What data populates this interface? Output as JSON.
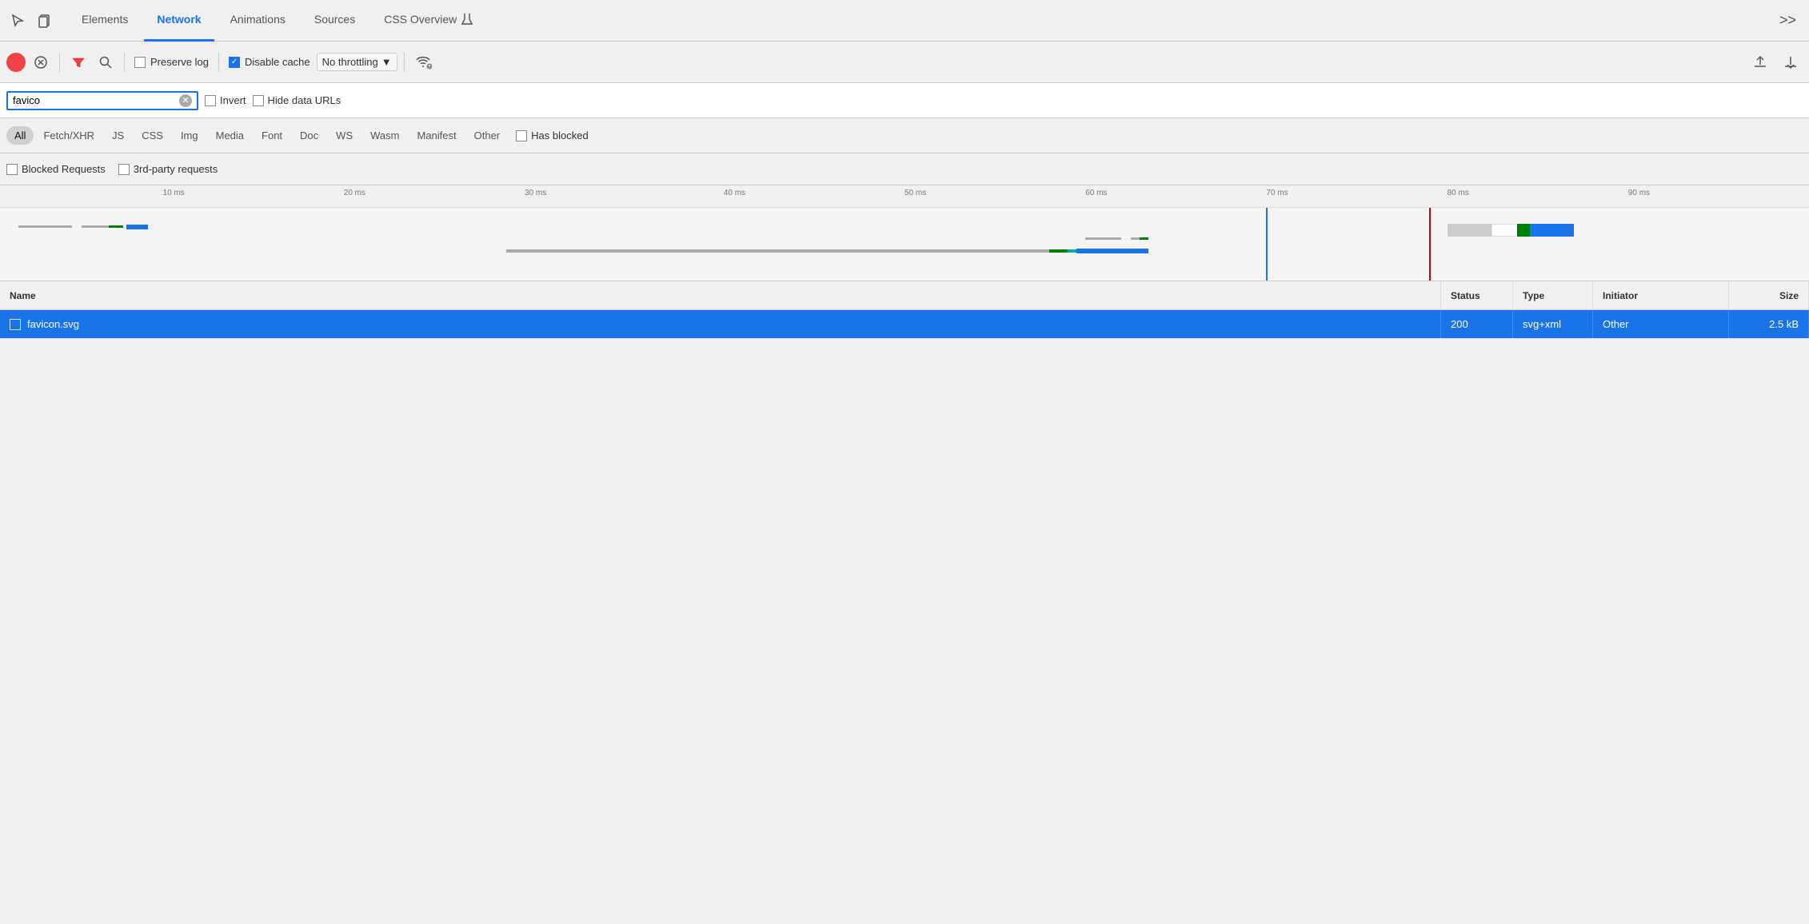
{
  "tabs": {
    "items": [
      {
        "label": "Elements",
        "active": false
      },
      {
        "label": "Network",
        "active": true
      },
      {
        "label": "Animations",
        "active": false
      },
      {
        "label": "Sources",
        "active": false
      },
      {
        "label": "CSS Overview",
        "active": false
      }
    ],
    "more_label": ">>"
  },
  "toolbar": {
    "preserve_log_label": "Preserve log",
    "disable_cache_label": "Disable cache",
    "disable_cache_checked": true,
    "throttle_label": "No throttling",
    "throttle_arrow": "▼"
  },
  "filter_bar": {
    "search_value": "favico",
    "search_placeholder": "Filter",
    "invert_label": "Invert",
    "hide_data_urls_label": "Hide data URLs"
  },
  "type_filters": {
    "items": [
      {
        "label": "All",
        "active": true
      },
      {
        "label": "Fetch/XHR",
        "active": false
      },
      {
        "label": "JS",
        "active": false
      },
      {
        "label": "CSS",
        "active": false
      },
      {
        "label": "Img",
        "active": false
      },
      {
        "label": "Media",
        "active": false
      },
      {
        "label": "Font",
        "active": false
      },
      {
        "label": "Doc",
        "active": false
      },
      {
        "label": "WS",
        "active": false
      },
      {
        "label": "Wasm",
        "active": false
      },
      {
        "label": "Manifest",
        "active": false
      },
      {
        "label": "Other",
        "active": false
      }
    ],
    "has_blocked_label": "Has blocked"
  },
  "blocked_bar": {
    "blocked_requests_label": "Blocked Requests",
    "third_party_label": "3rd-party requests"
  },
  "timeline": {
    "ruler_marks": [
      {
        "label": "10 ms",
        "left_pct": 9
      },
      {
        "label": "20 ms",
        "left_pct": 19
      },
      {
        "label": "30 ms",
        "left_pct": 30
      },
      {
        "label": "40 ms",
        "left_pct": 40
      },
      {
        "label": "50 ms",
        "left_pct": 50
      },
      {
        "label": "60 ms",
        "left_pct": 60
      },
      {
        "label": "70 ms",
        "left_pct": 70
      },
      {
        "label": "80 ms",
        "left_pct": 80
      },
      {
        "label": "90 ms",
        "left_pct": 90
      }
    ]
  },
  "table": {
    "headers": {
      "name": "Name",
      "status": "Status",
      "type": "Type",
      "initiator": "Initiator",
      "size": "Size"
    },
    "rows": [
      {
        "name": "favicon.svg",
        "status": "200",
        "type": "svg+xml",
        "initiator": "Other",
        "size": "2.5 kB",
        "selected": true
      }
    ]
  },
  "colors": {
    "active_tab_underline": "#1a73e8",
    "selected_row_bg": "#1a73e8",
    "record_btn": "#e44",
    "blue_vline": "#1a73e8",
    "red_vline": "#c00"
  }
}
